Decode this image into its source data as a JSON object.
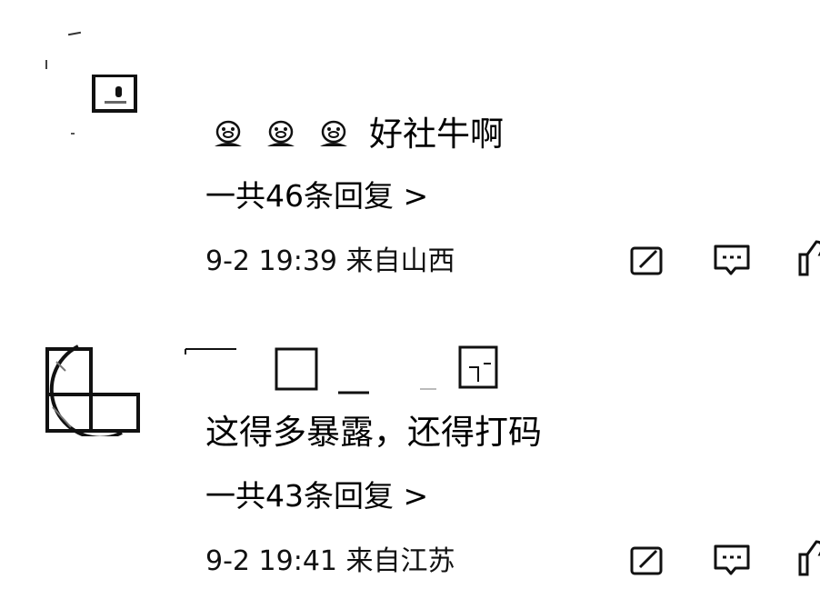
{
  "comments": [
    {
      "emojis": [
        "pig-face-emoji",
        "pig-face-emoji",
        "pig-face-emoji"
      ],
      "text": "好社牛啊",
      "replies_label": "一共46条回复 >",
      "meta": "9-2 19:39  来自山西",
      "actions": [
        "edit-icon",
        "comment-icon",
        "like-icon"
      ]
    },
    {
      "username": "",
      "text": "这得多暴露，还得打码",
      "replies_label": "一共43条回复 >",
      "meta": "9-2 19:41  来自江苏",
      "actions": [
        "edit-icon",
        "comment-icon",
        "like-icon"
      ]
    }
  ]
}
